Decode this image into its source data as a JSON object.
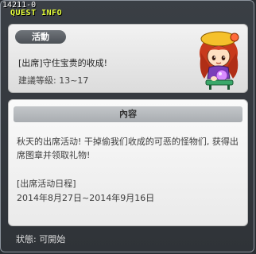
{
  "window": {
    "quest_id": "14211-0",
    "title": "QUEST INFO"
  },
  "summary": {
    "badge": "活動",
    "quest_name": "[出席]守住宝贵的收成!",
    "level_requirement": "建議等級: 13~17",
    "portrait": "npc-portrait-girl-icon"
  },
  "content": {
    "header": "內容",
    "description": "秋天的出席活动! 干掉偷我们收成的可恶的怪物们, 获得出席图章并领取礼物!",
    "schedule_title": "[出席活动日程]",
    "schedule_dates": "2014年8月27日~2014年9月16日"
  },
  "status": {
    "text": "狀態: 可開始"
  },
  "colors": {
    "title": "#e6ff3a",
    "window_bg": "#343a40",
    "panel_bg": "#eeeeee"
  }
}
